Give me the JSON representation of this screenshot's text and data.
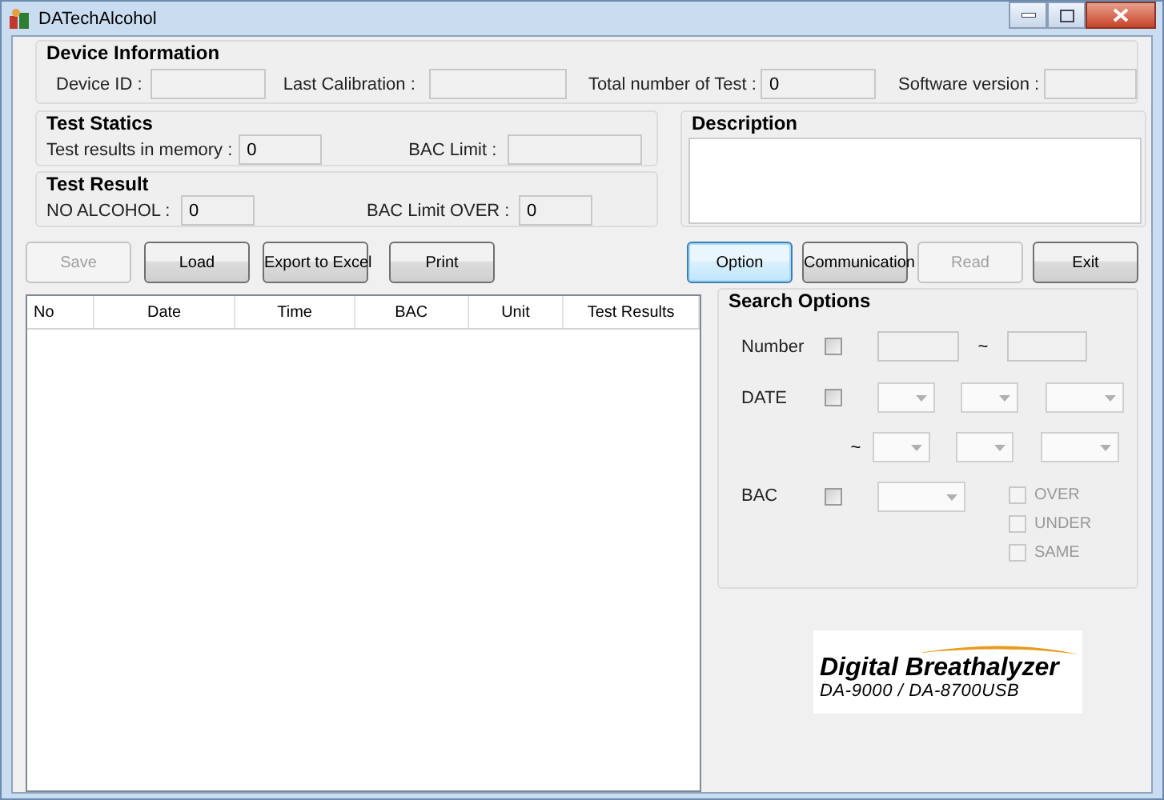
{
  "window": {
    "title": "DATechAlcohol"
  },
  "device_information": {
    "title": "Device Information",
    "fields": [
      {
        "label": "Device ID :"
      },
      {
        "label": "Last Calibration :"
      },
      {
        "label": "Total number of Test :",
        "value": "0"
      },
      {
        "label": "Software version :"
      }
    ]
  },
  "test_statics": {
    "title": "Test Statics",
    "fields": [
      {
        "label": "Test results in memory :",
        "value": "0"
      },
      {
        "label": "BAC Limit :"
      }
    ]
  },
  "test_result": {
    "title": "Test Result",
    "fields": [
      {
        "label": "NO ALCOHOL :",
        "value": "0"
      },
      {
        "label": "BAC Limit OVER :",
        "value": "0"
      }
    ]
  },
  "description": {
    "title": "Description"
  },
  "left_buttons": [
    {
      "label": "Save",
      "disabled": true,
      "focused": false
    },
    {
      "label": "Load",
      "disabled": false,
      "focused": false
    },
    {
      "label": "Export to Excel",
      "disabled": false,
      "focused": false
    },
    {
      "label": "Print",
      "disabled": false,
      "focused": false
    }
  ],
  "right_buttons": [
    {
      "label": "Option",
      "disabled": false,
      "focused": true
    },
    {
      "label": "Communication",
      "disabled": false,
      "focused": false
    },
    {
      "label": "Read",
      "disabled": true,
      "focused": false
    },
    {
      "label": "Exit",
      "disabled": false,
      "focused": false
    }
  ],
  "table": {
    "columns": [
      "No",
      "Date",
      "Time",
      "BAC",
      "Unit",
      "Test Results"
    ]
  },
  "search_options": {
    "title": "Search Options",
    "number": {
      "label": "Number",
      "checked": false,
      "separator": "~"
    },
    "date": {
      "label": "DATE",
      "checked": false,
      "separator": "~"
    },
    "bac": {
      "label": "BAC",
      "checked": false
    },
    "bac_options": [
      {
        "label": "OVER",
        "checked": false
      },
      {
        "label": "UNDER",
        "checked": false
      },
      {
        "label": "SAME",
        "checked": false
      }
    ]
  },
  "logo": {
    "title": "Digital Breathalyzer",
    "subtitle": "DA-9000 / DA-8700USB"
  }
}
